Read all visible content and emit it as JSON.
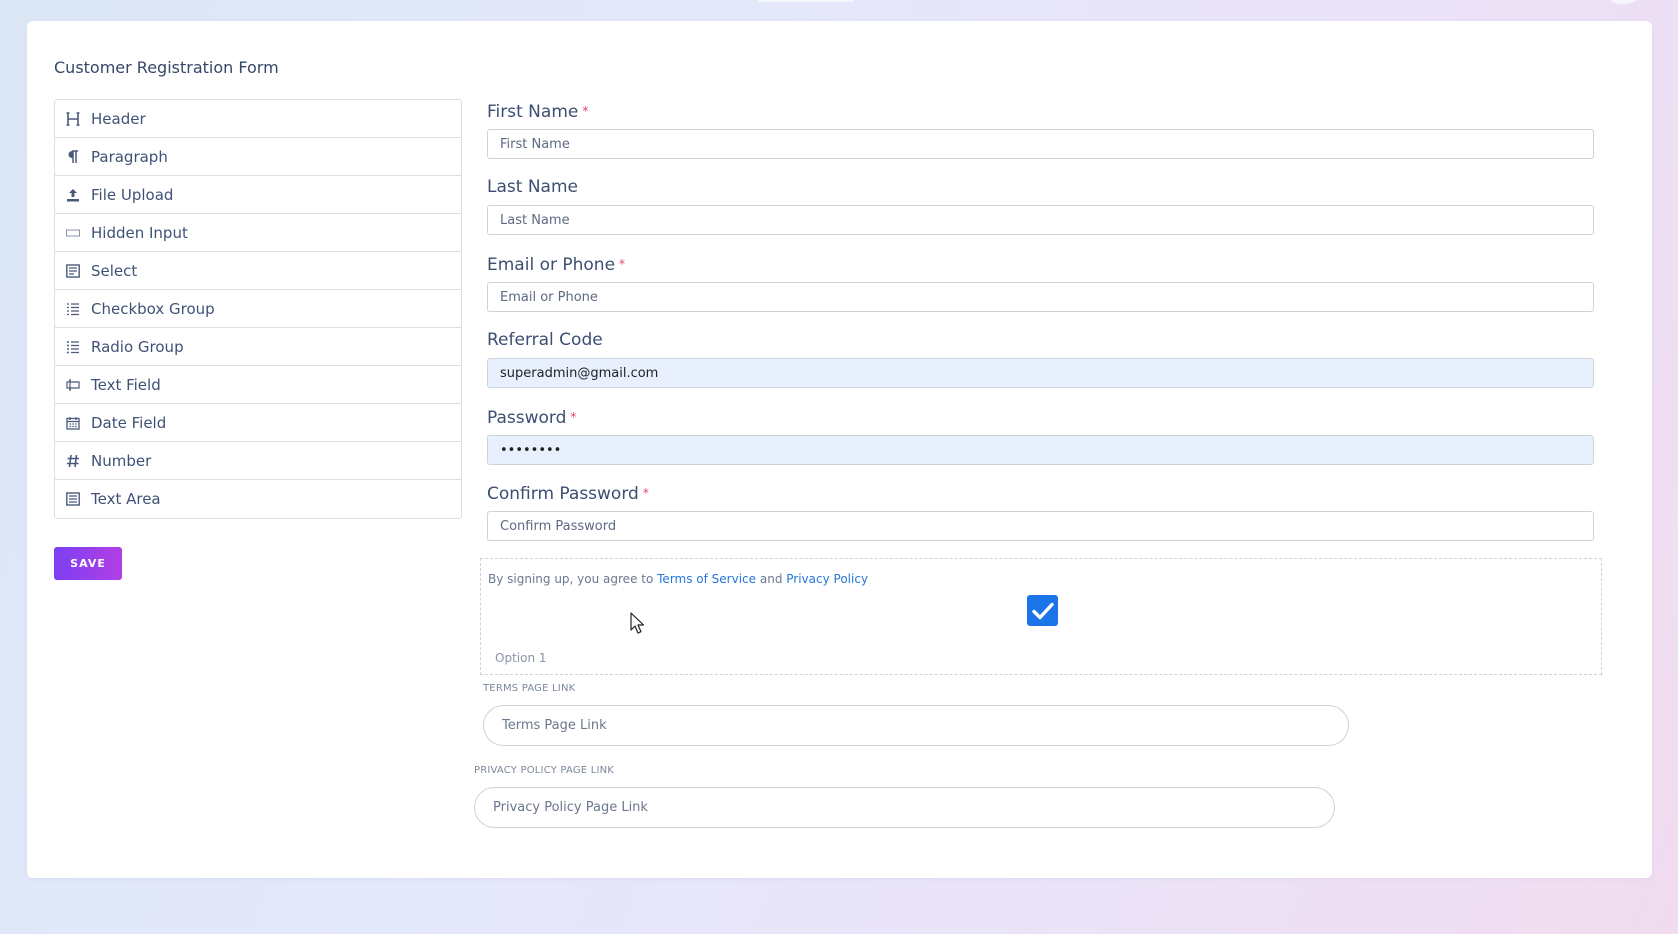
{
  "form": {
    "title": "Customer Registration Form",
    "save_label": "SAVE"
  },
  "palette": [
    {
      "label": "Header",
      "icon": "header-icon"
    },
    {
      "label": "Paragraph",
      "icon": "paragraph-icon"
    },
    {
      "label": "File Upload",
      "icon": "upload-icon"
    },
    {
      "label": "Hidden Input",
      "icon": "hidden-input-icon"
    },
    {
      "label": "Select",
      "icon": "select-icon"
    },
    {
      "label": "Checkbox Group",
      "icon": "checkbox-group-icon"
    },
    {
      "label": "Radio Group",
      "icon": "radio-group-icon"
    },
    {
      "label": "Text Field",
      "icon": "text-field-icon"
    },
    {
      "label": "Date Field",
      "icon": "calendar-icon"
    },
    {
      "label": "Number",
      "icon": "hash-icon"
    },
    {
      "label": "Text Area",
      "icon": "text-area-icon"
    }
  ],
  "fields": {
    "first_name": {
      "label": "First Name",
      "required": "*",
      "placeholder": "First Name",
      "value": ""
    },
    "last_name": {
      "label": "Last Name",
      "placeholder": "Last Name",
      "value": ""
    },
    "email": {
      "label": "Email or Phone",
      "required": "*",
      "placeholder": "Email or Phone",
      "value": ""
    },
    "referral": {
      "label": "Referral Code",
      "placeholder": "",
      "value": "superadmin@gmail.com"
    },
    "password": {
      "label": "Password",
      "required": "*",
      "placeholder": "",
      "value": "password"
    },
    "confirm": {
      "label": "Confirm Password",
      "required": "*",
      "placeholder": "Confirm Password",
      "value": ""
    }
  },
  "terms": {
    "prefix": "By signing up, you agree to",
    "tos_link": "Terms of Service",
    "and": "and",
    "privacy_link": "Privacy Policy",
    "checked": true,
    "option_label": "Option 1",
    "terms_link_label": "TERMS PAGE LINK",
    "terms_link_placeholder": "Terms Page Link",
    "privacy_link_label": "PRIVACY POLICY PAGE LINK",
    "privacy_link_placeholder": "Privacy Policy Page Link"
  },
  "colors": {
    "accent": "#1b74e8",
    "save_gradient_start": "#7b3ff2",
    "save_gradient_end": "#b33fe6",
    "required": "#e0446b",
    "link": "#2676d9"
  }
}
